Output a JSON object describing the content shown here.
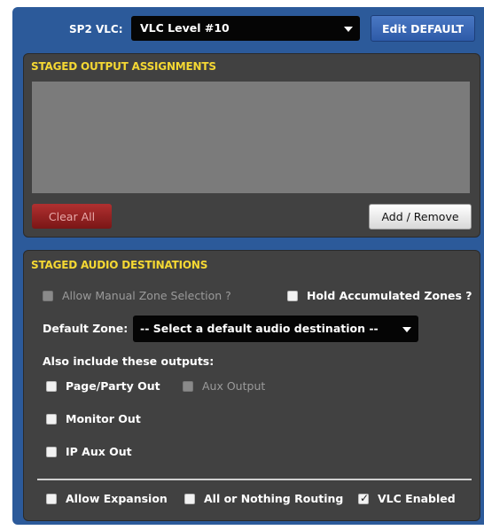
{
  "header": {
    "vlc_label": "SP2 VLC:",
    "vlc_value": "VLC Level #10",
    "edit_default_label": "Edit DEFAULT"
  },
  "staged_output": {
    "title": "STAGED OUTPUT ASSIGNMENTS",
    "clear_all_label": "Clear All",
    "add_remove_label": "Add / Remove"
  },
  "staged_audio": {
    "title": "STAGED AUDIO DESTINATIONS",
    "allow_manual_label": "Allow Manual Zone Selection ?",
    "hold_accumulated_label": "Hold Accumulated Zones ?",
    "default_zone_label": "Default Zone:",
    "default_zone_value": "-- Select a default audio destination --",
    "also_include_label": "Also include these outputs:",
    "page_party_label": "Page/Party Out",
    "aux_output_label": "Aux Output",
    "monitor_out_label": "Monitor Out",
    "ip_aux_out_label": "IP Aux Out",
    "allow_expansion_label": "Allow Expansion",
    "all_or_nothing_label": "All or Nothing Routing",
    "vlc_enabled_label": "VLC Enabled"
  },
  "colors": {
    "frame_blue": "#2c5a9a",
    "panel_gray": "#414141",
    "title_yellow": "#f5d833",
    "clear_red": "#9a2222"
  },
  "states": {
    "allow_manual_checked": false,
    "hold_accumulated_checked": false,
    "page_party_checked": false,
    "aux_output_checked": false,
    "monitor_out_checked": false,
    "ip_aux_out_checked": false,
    "allow_expansion_checked": false,
    "all_or_nothing_checked": false,
    "vlc_enabled_checked": true
  }
}
